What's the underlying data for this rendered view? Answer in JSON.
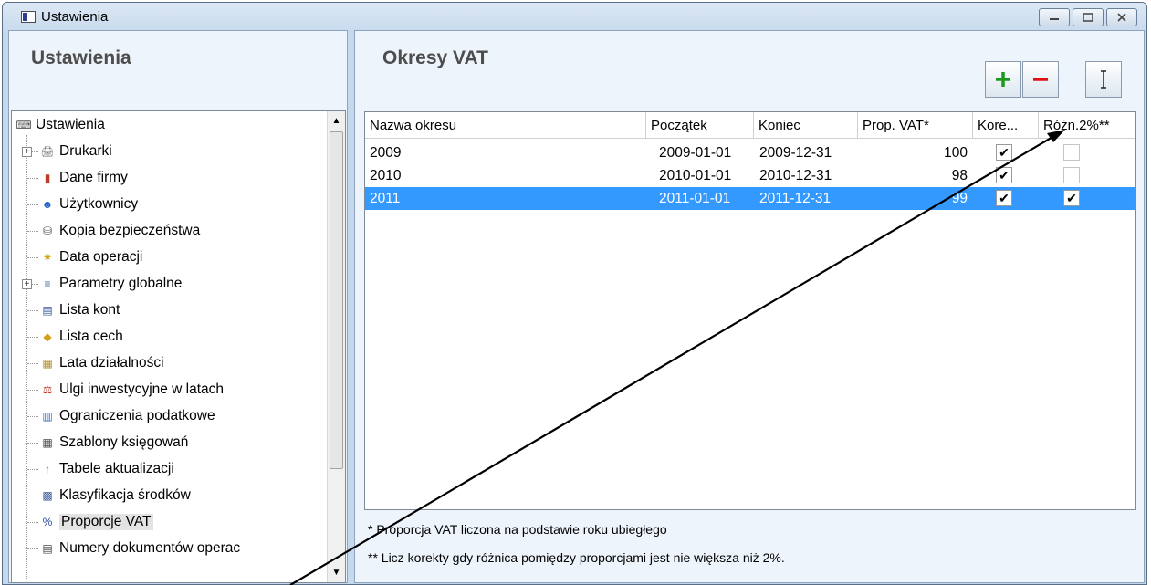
{
  "window": {
    "title": "Ustawienia"
  },
  "left": {
    "header": "Ustawienia",
    "tree": [
      {
        "label": "Ustawienia",
        "icon": "keyboard-icon",
        "level": 0
      },
      {
        "label": "Drukarki",
        "icon": "printer-icon",
        "level": 1,
        "expandable": true
      },
      {
        "label": "Dane firmy",
        "icon": "company-book-icon",
        "level": 1
      },
      {
        "label": "Użytkownicy",
        "icon": "users-icon",
        "level": 1
      },
      {
        "label": "Kopia bezpieczeństwa",
        "icon": "backup-icon",
        "level": 1
      },
      {
        "label": "Data operacji",
        "icon": "date-icon",
        "level": 1
      },
      {
        "label": "Parametry globalne",
        "icon": "parameters-icon",
        "level": 1,
        "expandable": true
      },
      {
        "label": "Lista kont",
        "icon": "accounts-list-icon",
        "level": 1
      },
      {
        "label": "Lista cech",
        "icon": "tag-icon",
        "level": 1
      },
      {
        "label": "Lata działalności",
        "icon": "calendar-icon",
        "level": 1
      },
      {
        "label": "Ulgi inwestycyjne w latach",
        "icon": "investment-icon",
        "level": 1
      },
      {
        "label": "Ograniczenia podatkowe",
        "icon": "tax-limits-icon",
        "level": 1
      },
      {
        "label": "Szablony księgowań",
        "icon": "templates-icon",
        "level": 1
      },
      {
        "label": "Tabele aktualizacji",
        "icon": "update-tables-icon",
        "level": 1
      },
      {
        "label": "Klasyfikacja środków",
        "icon": "classification-icon",
        "level": 1
      },
      {
        "label": "Proporcje VAT",
        "icon": "vat-proportion-icon",
        "level": 1,
        "selected": true
      },
      {
        "label": "Numery dokumentów operac",
        "icon": "document-numbers-icon",
        "level": 1
      }
    ]
  },
  "right": {
    "header": "Okresy VAT",
    "buttons": {
      "add": "+",
      "remove": "−",
      "cursor": "I"
    },
    "columns": [
      "Nazwa okresu",
      "Początek",
      "Koniec",
      "Prop. VAT*",
      "Kore...",
      "Różn.2%**"
    ],
    "rows": [
      {
        "name": "2009",
        "start": "2009-01-01",
        "end": "2009-12-31",
        "prop": "100",
        "kore": true,
        "rozn": false,
        "selected": false
      },
      {
        "name": "2010",
        "start": "2010-01-01",
        "end": "2010-12-31",
        "prop": "98",
        "kore": true,
        "rozn": false,
        "selected": false
      },
      {
        "name": "2011",
        "start": "2011-01-01",
        "end": "2011-12-31",
        "prop": "99",
        "kore": true,
        "rozn": true,
        "selected": true
      }
    ],
    "footnotes": [
      "* Proporcja VAT liczona na podstawie roku ubiegłego",
      "** Licz korekty gdy różnica pomiędzy proporcjami jest nie większa niż 2%."
    ]
  }
}
